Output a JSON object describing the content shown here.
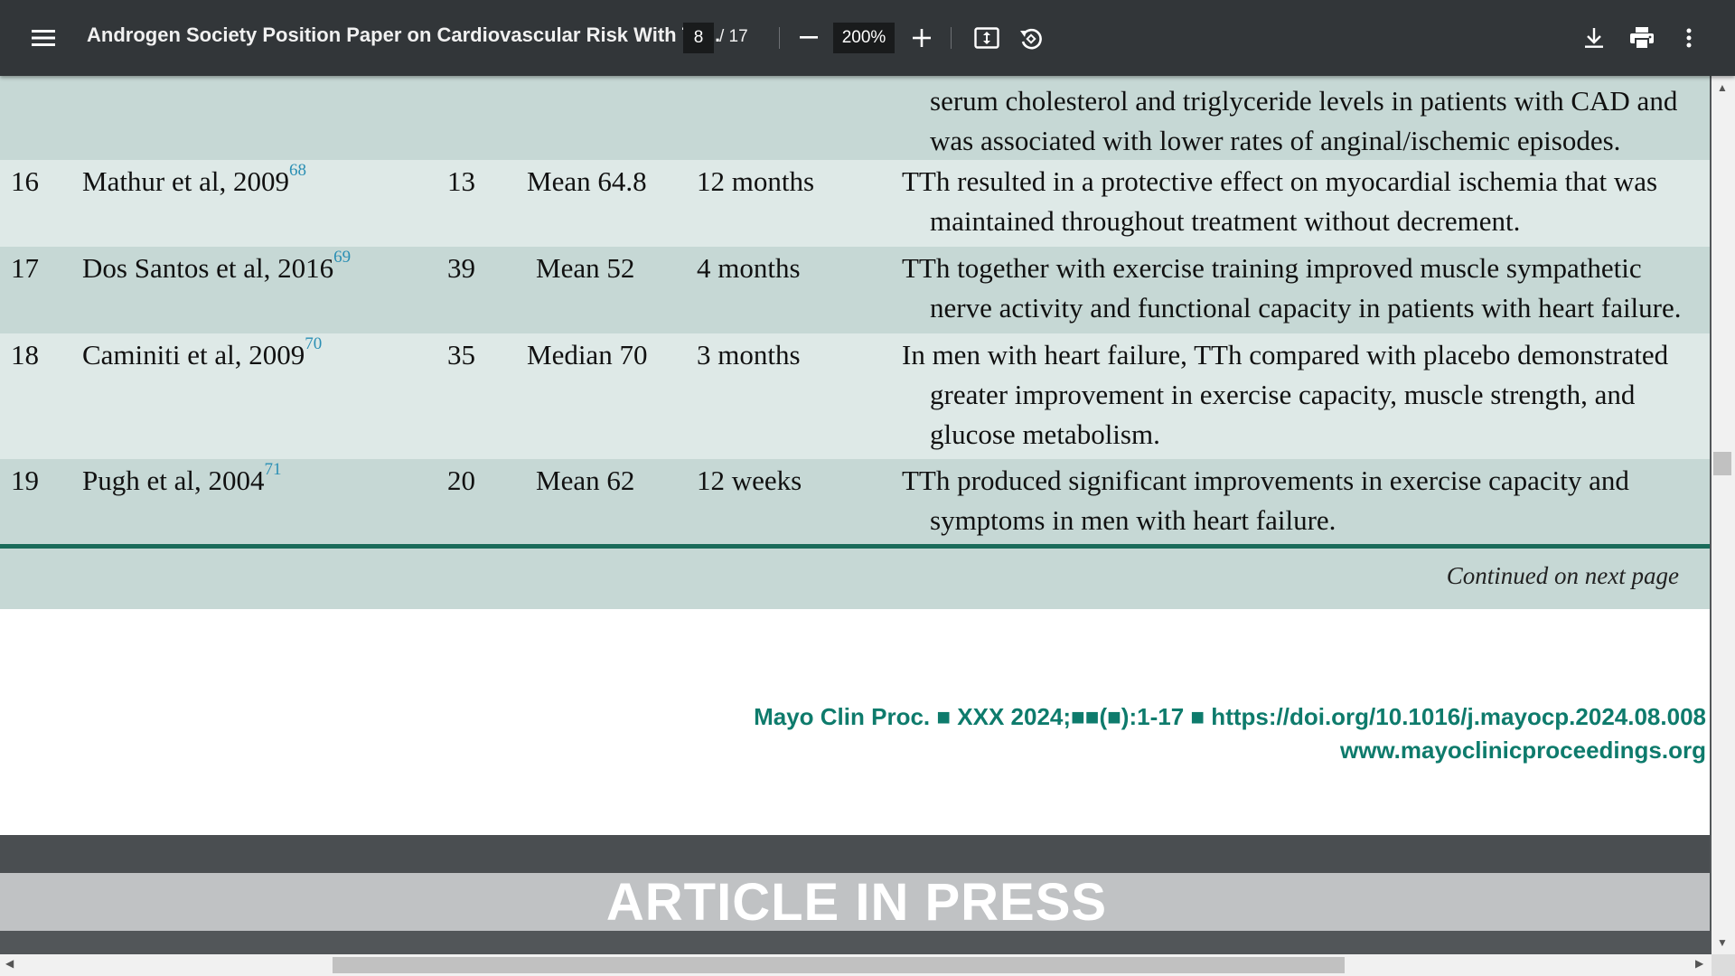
{
  "toolbar": {
    "title": "Androgen Society Position Paper on Cardiovascular Risk With Te...",
    "current_page": "8",
    "total_pages": "/ 17",
    "zoom": "200%",
    "icons": [
      "menu-icon",
      "minus-icon",
      "plus-icon",
      "fit-page-icon",
      "rotate-icon",
      "download-icon",
      "print-icon",
      "more-vert-icon"
    ]
  },
  "table": {
    "partial_row": {
      "lines": [
        "serum cholesterol and triglyceride levels in patients with CAD and",
        "was associated with lower rates of anginal/ischemic episodes."
      ]
    },
    "rows": [
      {
        "num": "16",
        "study": "Mathur et al, 2009",
        "ref": "68",
        "n": "13",
        "age": "Mean 64.8",
        "duration": "12 months",
        "lines": [
          "TTh resulted in a protective effect on myocardial ischemia that was",
          "maintained throughout treatment without decrement."
        ]
      },
      {
        "num": "17",
        "study": "Dos Santos et al, 2016",
        "ref": "69",
        "n": "39",
        "age": "Mean 52",
        "duration": "4 months",
        "lines": [
          "TTh together with exercise training improved muscle sympathetic",
          "nerve activity and functional capacity in patients with heart failure."
        ]
      },
      {
        "num": "18",
        "study": "Caminiti et al, 2009",
        "ref": "70",
        "n": "35",
        "age": "Median 70",
        "duration": "3 months",
        "lines": [
          "In men with heart failure, TTh compared with placebo demonstrated",
          "greater improvement in exercise capacity, muscle strength, and",
          "glucose metabolism."
        ]
      },
      {
        "num": "19",
        "study": "Pugh et al, 2004",
        "ref": "71",
        "n": "20",
        "age": "Mean 62",
        "duration": "12 weeks",
        "lines": [
          "TTh produced significant improvements in exercise capacity and",
          "symptoms in men with heart failure."
        ]
      }
    ],
    "continued": "Continued on next page"
  },
  "footer": {
    "citation": "Mayo Clin Proc. ■ XXX 2024;■■(■):1-17 ■ https://doi.org/10.1016/j.mayocp.2024.08.008",
    "website": "www.mayoclinicproceedings.org"
  },
  "next_page_banner": "ARTICLE IN PRESS",
  "colors": {
    "toolbar_bg": "#323639",
    "row_dark": "#c6d8d5",
    "row_light": "#dee9e7",
    "rule": "#1a6b5a",
    "journal_text": "#0e7b6c",
    "ref_superscript": "#2b8fb4"
  }
}
